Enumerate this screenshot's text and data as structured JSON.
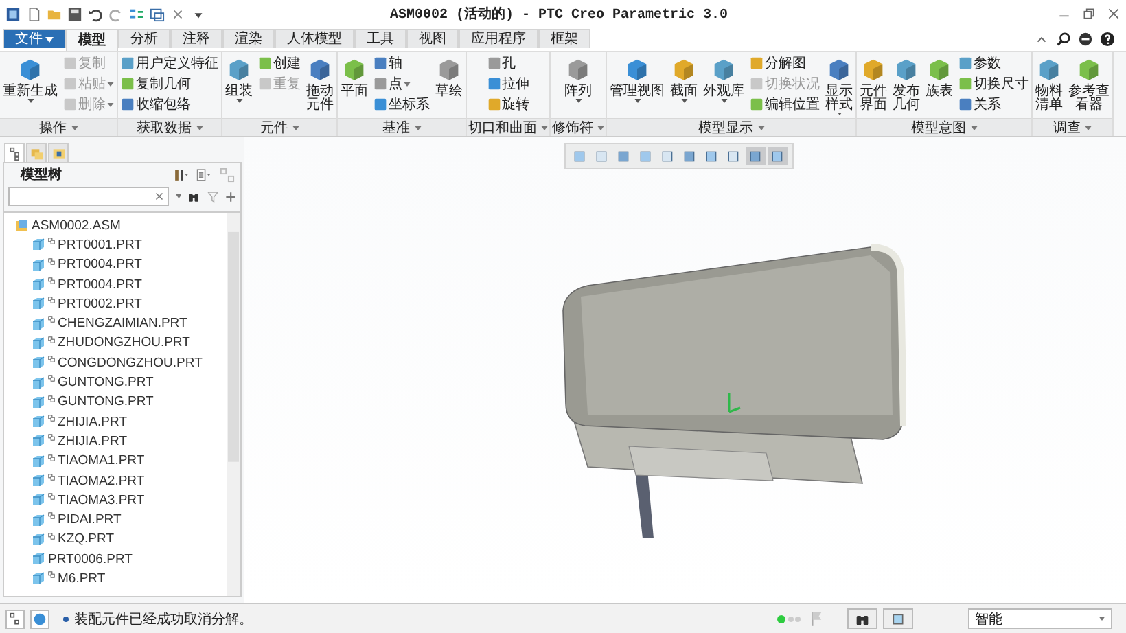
{
  "window": {
    "title": "ASM0002 (活动的) - PTC Creo Parametric 3.0"
  },
  "tabs": [
    {
      "label": "文件",
      "selected": false,
      "dropdown": true
    },
    {
      "label": "模型",
      "selected": true
    },
    {
      "label": "分析",
      "selected": false
    },
    {
      "label": "注释",
      "selected": false
    },
    {
      "label": "渲染",
      "selected": false
    },
    {
      "label": "人体模型",
      "selected": false
    },
    {
      "label": "工具",
      "selected": false
    },
    {
      "label": "视图",
      "selected": false
    },
    {
      "label": "应用程序",
      "selected": false
    },
    {
      "label": "框架",
      "selected": false
    }
  ],
  "ribbon": {
    "groups": [
      {
        "label": "操作",
        "columns": [
          {
            "kind": "large",
            "items": [
              {
                "label": "重新生成",
                "disabled": false,
                "dropdown": true
              }
            ]
          },
          {
            "kind": "stack",
            "items": [
              {
                "label": "复制",
                "disabled": true
              },
              {
                "label": "粘贴",
                "disabled": true,
                "dropdown": true
              },
              {
                "label": "删除",
                "disabled": true,
                "dropdown": true
              }
            ]
          }
        ]
      },
      {
        "label": "获取数据",
        "columns": [
          {
            "kind": "stack",
            "items": [
              {
                "label": "用户定义特征",
                "disabled": false
              },
              {
                "label": "复制几何",
                "disabled": false
              },
              {
                "label": "收缩包络",
                "disabled": false
              }
            ]
          }
        ]
      },
      {
        "label": "元件",
        "columns": [
          {
            "kind": "large",
            "items": [
              {
                "label": "组装",
                "disabled": false,
                "dropdown": true
              }
            ]
          },
          {
            "kind": "stack",
            "items": [
              {
                "label": "创建",
                "disabled": false
              },
              {
                "label": "重复",
                "disabled": true
              }
            ]
          },
          {
            "kind": "large",
            "items": [
              {
                "label": "拖动元件",
                "disabled": false,
                "wrapped": true
              }
            ]
          }
        ]
      },
      {
        "label": "基准",
        "columns": [
          {
            "kind": "large",
            "items": [
              {
                "label": "平面",
                "disabled": false
              }
            ]
          },
          {
            "kind": "stack",
            "items": [
              {
                "label": "轴",
                "disabled": false
              },
              {
                "label": "点",
                "disabled": false,
                "dropdown": true
              },
              {
                "label": "坐标系",
                "disabled": false
              }
            ]
          },
          {
            "kind": "large",
            "items": [
              {
                "label": "草绘",
                "disabled": false
              }
            ]
          }
        ]
      },
      {
        "label": "切口和曲面",
        "columns": [
          {
            "kind": "stack",
            "items": [
              {
                "label": "孔",
                "disabled": false
              },
              {
                "label": "拉伸",
                "disabled": false
              },
              {
                "label": "旋转",
                "disabled": false
              }
            ]
          }
        ]
      },
      {
        "label": "修饰符",
        "columns": [
          {
            "kind": "large",
            "items": [
              {
                "label": "阵列",
                "disabled": false,
                "dropdown": true
              }
            ]
          }
        ]
      },
      {
        "label": "模型显示",
        "columns": [
          {
            "kind": "large",
            "items": [
              {
                "label": "管理视图",
                "disabled": false,
                "dropdown": true
              }
            ]
          },
          {
            "kind": "large",
            "items": [
              {
                "label": "截面",
                "disabled": false,
                "dropdown": true
              }
            ]
          },
          {
            "kind": "large",
            "items": [
              {
                "label": "外观库",
                "disabled": false,
                "dropdown": true
              }
            ]
          },
          {
            "kind": "stack",
            "items": [
              {
                "label": "分解图",
                "disabled": false
              },
              {
                "label": "切换状况",
                "disabled": true
              },
              {
                "label": "编辑位置",
                "disabled": false
              }
            ]
          },
          {
            "kind": "large",
            "items": [
              {
                "label": "显示样式",
                "disabled": false,
                "dropdown": true,
                "wrapped": true
              }
            ]
          }
        ]
      },
      {
        "label": "模型意图",
        "columns": [
          {
            "kind": "large",
            "items": [
              {
                "label": "元件界面",
                "disabled": false,
                "wrapped": true
              }
            ]
          },
          {
            "kind": "large",
            "items": [
              {
                "label": "发布几何",
                "disabled": false,
                "wrapped": true
              }
            ]
          },
          {
            "kind": "large",
            "items": [
              {
                "label": "族表",
                "disabled": false
              }
            ]
          },
          {
            "kind": "stack",
            "items": [
              {
                "label": "参数",
                "disabled": false
              },
              {
                "label": "切换尺寸",
                "disabled": false
              },
              {
                "label": "关系",
                "disabled": false
              }
            ]
          }
        ]
      },
      {
        "label": "调查",
        "columns": [
          {
            "kind": "large",
            "items": [
              {
                "label": "物料清单",
                "disabled": false,
                "wrapped": true
              }
            ]
          },
          {
            "kind": "large",
            "items": [
              {
                "label": "参考查看器",
                "disabled": false,
                "wrapped": true
              }
            ]
          }
        ]
      }
    ]
  },
  "graphics_toolbar": [
    {
      "on": false
    },
    {
      "on": false
    },
    {
      "on": false
    },
    {
      "on": false
    },
    {
      "on": false
    },
    {
      "on": false
    },
    {
      "on": false
    },
    {
      "on": false
    },
    {
      "on": true
    },
    {
      "on": true
    }
  ],
  "model_tree": {
    "panel_tabs": [
      {
        "selected": true
      },
      {
        "selected": false
      },
      {
        "selected": false
      }
    ],
    "title": "模型树",
    "items": [
      {
        "label": "ASM0002.ASM",
        "children": [
          {
            "label": "PRT0001.PRT",
            "linked": true
          },
          {
            "label": "PRT0004.PRT",
            "linked": true
          },
          {
            "label": "PRT0004.PRT",
            "linked": true
          },
          {
            "label": "PRT0002.PRT",
            "linked": true
          },
          {
            "label": "CHENGZAIMIAN.PRT",
            "linked": true
          },
          {
            "label": "ZHUDONGZHOU.PRT",
            "linked": true
          },
          {
            "label": "CONGDONGZHOU.PRT",
            "linked": true
          },
          {
            "label": "GUNTONG.PRT",
            "linked": true
          },
          {
            "label": "GUNTONG.PRT",
            "linked": true
          },
          {
            "label": "ZHIJIA.PRT",
            "linked": true
          },
          {
            "label": "ZHIJIA.PRT",
            "linked": true
          },
          {
            "label": "TIAOMA1.PRT",
            "linked": true
          },
          {
            "label": "TIAOMA2.PRT",
            "linked": true
          },
          {
            "label": "TIAOMA3.PRT",
            "linked": true
          },
          {
            "label": "PIDAI.PRT",
            "linked": true
          },
          {
            "label": "KZQ.PRT",
            "linked": true
          },
          {
            "label": "PRT0006.PRT",
            "linked": false
          },
          {
            "label": "M6.PRT",
            "linked": true
          }
        ]
      }
    ]
  },
  "status_bar": {
    "message": "装配元件已经成功取消分解。",
    "filter": "智能"
  }
}
